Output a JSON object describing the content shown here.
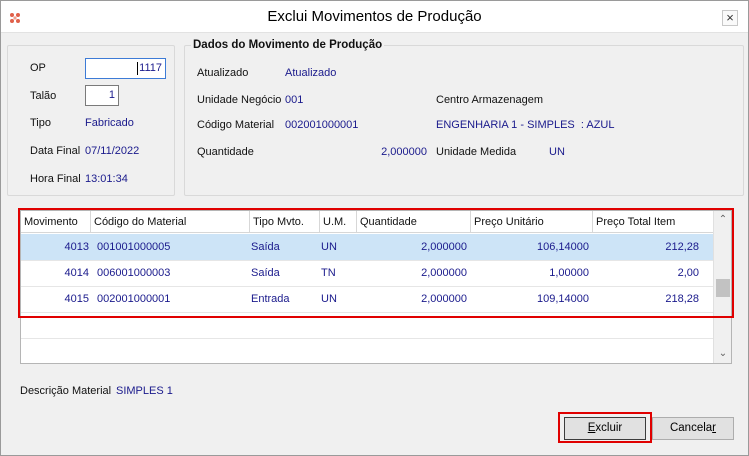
{
  "window": {
    "title": "Exclui Movimentos de Produção",
    "close_glyph": "×"
  },
  "left_panel": {
    "op_label": "OP",
    "op_value": "1117",
    "talao_label": "Talão",
    "talao_value": "1",
    "tipo_label": "Tipo",
    "tipo_value": "Fabricado",
    "data_final_label": "Data Final",
    "data_final_value": "07/11/2022",
    "hora_final_label": "Hora Final",
    "hora_final_value": "13:01:34"
  },
  "movement_panel": {
    "title": "Dados do Movimento de Produção",
    "atualizado_label": "Atualizado",
    "atualizado_value": "Atualizado",
    "unidade_negocio_label": "Unidade Negócio",
    "unidade_negocio_value": "001",
    "centro_armazenagem_label": "Centro Armazenagem",
    "codigo_material_label": "Código Material",
    "codigo_material_value": "002001000001",
    "material_description": "ENGENHARIA 1 - SIMPLES  : AZUL",
    "quantidade_label": "Quantidade",
    "quantidade_value": "2,000000",
    "unidade_medida_label": "Unidade Medida",
    "unidade_medida_value": "UN"
  },
  "grid": {
    "columns": [
      "Movimento",
      "Código do Material",
      "Tipo Mvto.",
      "U.M.",
      "Quantidade",
      "Preço Unitário",
      "Preço Total Item"
    ],
    "rows": [
      {
        "movimento": "4013",
        "codigo": "001001000005",
        "tipo": "Saída",
        "um": "UN",
        "quantidade": "2,000000",
        "preco_unitario": "106,14000",
        "preco_total": "212,28",
        "selected": true
      },
      {
        "movimento": "4014",
        "codigo": "006001000003",
        "tipo": "Saída",
        "um": "TN",
        "quantidade": "2,000000",
        "preco_unitario": "1,00000",
        "preco_total": "2,00",
        "selected": false
      },
      {
        "movimento": "4015",
        "codigo": "002001000001",
        "tipo": "Entrada",
        "um": "UN",
        "quantidade": "2,000000",
        "preco_unitario": "109,14000",
        "preco_total": "218,28",
        "selected": false
      }
    ],
    "scroll_up_glyph": "⌃",
    "scroll_down_glyph": "⌄"
  },
  "footer": {
    "descricao_label": "Descrição Material",
    "descricao_value": "SIMPLES 1",
    "excluir_label_first": "E",
    "excluir_label_rest": "xcluir",
    "cancelar_label_main": "Cancela",
    "cancelar_label_underline": "r"
  },
  "colors": {
    "value_text": "#1a1a8c",
    "selected_row": "#cde4f7",
    "highlight_border": "#e00000"
  }
}
